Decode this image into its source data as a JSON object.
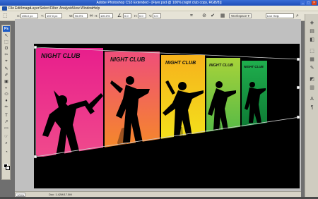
{
  "window": {
    "title": "Adobe Photoshop CS3 Extended - [Flyer.psd @ 100% (night club copy, RGB/8)]",
    "minimize": "_",
    "maximize": "□",
    "close": "×"
  },
  "menu": {
    "items": [
      "File",
      "Edit",
      "Image",
      "Layer",
      "Select",
      "Filter",
      "Analysis",
      "View",
      "Window",
      "Help"
    ]
  },
  "options_bar": {
    "x_label": "X:",
    "x_value": "496.0 px",
    "y_label": "Y:",
    "y_value": "157.0 px",
    "w_label": "W:",
    "w_value": "96.9%",
    "h_label": "H:",
    "h_value": "100.0%",
    "angle_value": "0.0",
    "hskew_label": "H:",
    "hskew_value": "0.0",
    "vskew_label": "V:",
    "vskew_value": "0.0",
    "cancel_icon": "⊘",
    "commit_icon": "✔",
    "workspace_label": "Workspace ▾",
    "search_placeholder": "Live Help"
  },
  "toolbox": {
    "badge": "Ps",
    "tools": [
      "↖",
      "⬚",
      "ʘ",
      "✂",
      "⌖",
      "✎",
      "✐",
      "▣",
      "◐",
      "⬭",
      "♦",
      "✏",
      "T",
      "↗",
      "▭",
      "☞",
      "⌕",
      "◔"
    ]
  },
  "canvas": {
    "panel_label": "NIGHT CLUB",
    "panel_colors": [
      "#e8208e",
      "#f26522",
      "#f7d417",
      "#8bc63e",
      "#1ea84a"
    ]
  },
  "dock": {
    "icons": [
      "◈",
      "▤",
      "◧",
      "⬚",
      "▦",
      "✎",
      "◩",
      "▥",
      "A",
      "¶"
    ]
  },
  "status": {
    "zoom": "100%",
    "doc_info": "Doc: 1.42M/17.5M"
  }
}
